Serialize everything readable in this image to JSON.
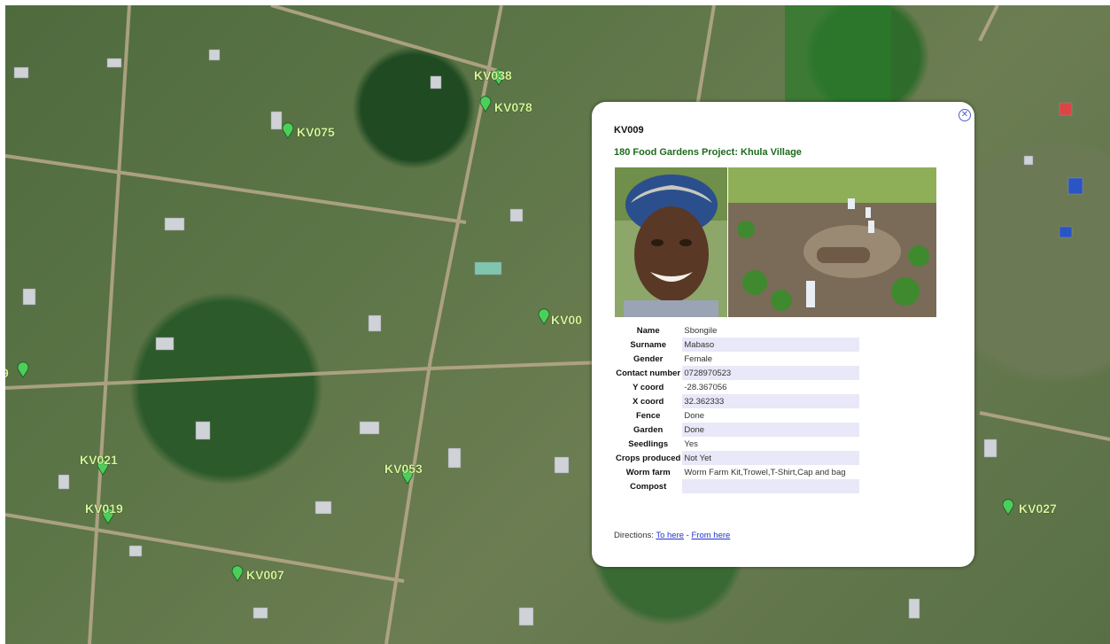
{
  "map": {
    "markers": [
      {
        "label": "KV038"
      },
      {
        "label": "KV078"
      },
      {
        "label": "KV075"
      },
      {
        "label": "KV00"
      },
      {
        "label": "9"
      },
      {
        "label": "KV021"
      },
      {
        "label": "KV019"
      },
      {
        "label": "KV053"
      },
      {
        "label": "KV007"
      },
      {
        "label": "KV027"
      }
    ],
    "marker_color": "#4ccf5a",
    "label_color": "#d6f59a"
  },
  "popup": {
    "title": "KV009",
    "subtitle": "180 Food Gardens Project: Khula Village",
    "close_icon": "close-icon",
    "details": [
      {
        "key": "Name",
        "value": "Sbongile"
      },
      {
        "key": "Surname",
        "value": "Mabaso"
      },
      {
        "key": "Gender",
        "value": "Female"
      },
      {
        "key": "Contact number",
        "value": "0728970523"
      },
      {
        "key": "Y coord",
        "value": "-28.367056"
      },
      {
        "key": "X coord",
        "value": "32.362333"
      },
      {
        "key": "Fence",
        "value": "Done"
      },
      {
        "key": "Garden",
        "value": "Done"
      },
      {
        "key": "Seedlings",
        "value": "Yes"
      },
      {
        "key": "Crops produced",
        "value": "Not Yet"
      },
      {
        "key": "Worm farm",
        "value": "Worm Farm Kit,Trowel,T-Shirt,Cap and bag"
      },
      {
        "key": "Compost",
        "value": ""
      }
    ],
    "directions_label": "Directions:",
    "to_here": "To here",
    "separator": "-",
    "from_here": "From here",
    "subtitle_color": "#1d6b1d",
    "link_color": "#2233cc"
  }
}
